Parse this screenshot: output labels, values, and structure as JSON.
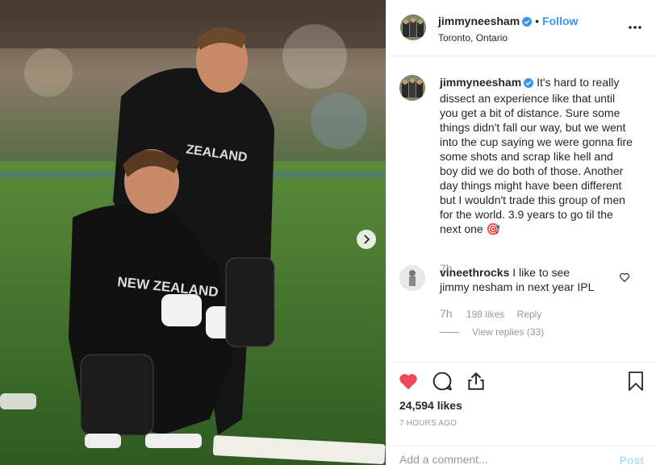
{
  "post": {
    "username": "jimmyneesham",
    "follow_label": "Follow",
    "separator": "•",
    "location": "Toronto, Ontario",
    "caption": "It's hard to really dissect an experience like that until you get a bit of distance. Sure some things didn't fall our way, but we went into the cup saying we were gonna fire some shots and scrap like hell and boy did we do both of those. Another day things might have been different but I wouldn't trade this group of men for the world. 3.9 years to go til the next one 🎯",
    "caption_time": "7h"
  },
  "comment": {
    "username": "vineethrocks",
    "text": "I like to see jimmy nesham in next year IPL",
    "time": "7h",
    "likes": "198 likes",
    "reply_label": "Reply",
    "view_replies": "View replies (33)"
  },
  "actions": {
    "likes_count": "24,594 likes",
    "timestamp": "7 HOURS AGO",
    "liked": true
  },
  "add_comment": {
    "placeholder": "Add a comment...",
    "post_label": "Post"
  },
  "colors": {
    "accent": "#3897f0",
    "heart": "#ed4956",
    "muted": "#999999",
    "post_disabled": "#b2dffc"
  },
  "icons": [
    "verified-icon",
    "more-options-icon",
    "heart-icon",
    "comment-icon",
    "share-icon",
    "bookmark-icon",
    "next-arrow-icon"
  ]
}
